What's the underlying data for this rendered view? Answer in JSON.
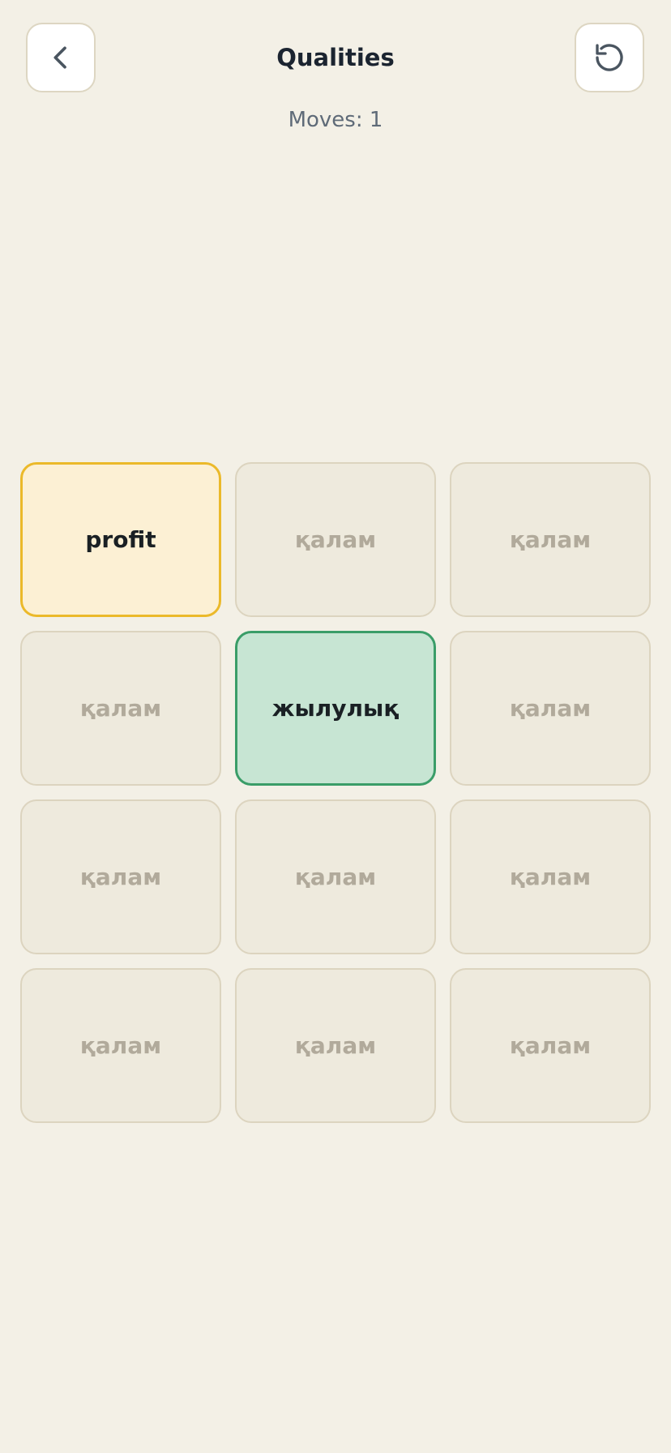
{
  "header": {
    "title": "Qualities",
    "back_icon": "chevron-left-icon",
    "reset_icon": "rotate-ccw-icon"
  },
  "moves_text": "Moves: 1",
  "colors": {
    "background": "#f3f0e6",
    "tile_default": "#eeeadd",
    "tile_selected_yellow": "#fcf0d4",
    "tile_selected_yellow_border": "#ebb92a",
    "tile_matched_green": "#c7e5d3",
    "tile_matched_green_border": "#3a9d68"
  },
  "tiles": [
    {
      "label": "profit",
      "state": "selected"
    },
    {
      "label": "қалам",
      "state": "hidden"
    },
    {
      "label": "қалам",
      "state": "hidden"
    },
    {
      "label": "қалам",
      "state": "hidden"
    },
    {
      "label": "жылулық",
      "state": "revealed"
    },
    {
      "label": "қалам",
      "state": "hidden"
    },
    {
      "label": "қалам",
      "state": "hidden"
    },
    {
      "label": "қалам",
      "state": "hidden"
    },
    {
      "label": "қалам",
      "state": "hidden"
    },
    {
      "label": "қалам",
      "state": "hidden"
    },
    {
      "label": "қалам",
      "state": "hidden"
    },
    {
      "label": "қалам",
      "state": "hidden"
    }
  ]
}
